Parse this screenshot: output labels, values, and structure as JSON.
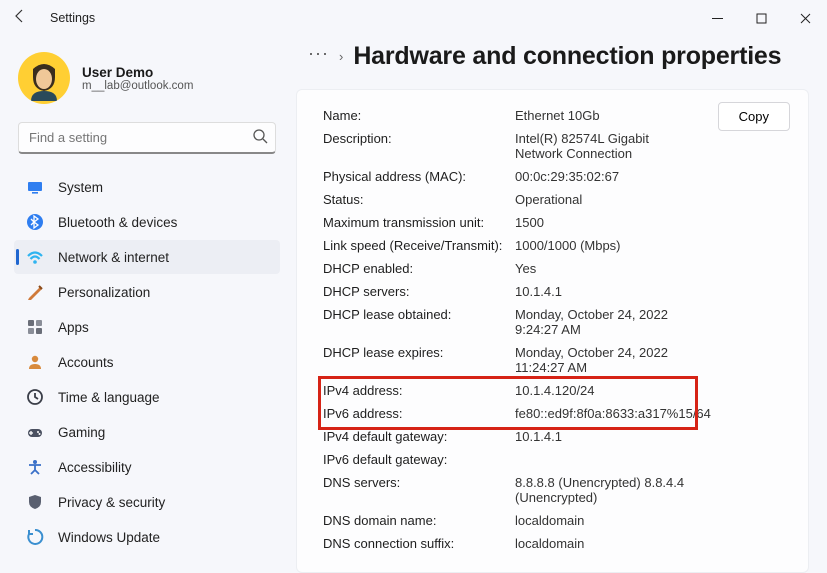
{
  "window": {
    "title": "Settings"
  },
  "user": {
    "name": "User Demo",
    "email": "m__lab@outlook.com"
  },
  "search": {
    "placeholder": "Find a setting"
  },
  "nav": [
    {
      "id": "system",
      "label": "System",
      "icon": "system",
      "color": "#2f7ef0"
    },
    {
      "id": "bluetooth",
      "label": "Bluetooth & devices",
      "icon": "bluetooth",
      "color": "#2f7ef0"
    },
    {
      "id": "network",
      "label": "Network & internet",
      "icon": "wifi",
      "color": "#2fb4f0",
      "selected": true
    },
    {
      "id": "personalization",
      "label": "Personalization",
      "icon": "personalization",
      "color": "#d07a3a"
    },
    {
      "id": "apps",
      "label": "Apps",
      "icon": "apps",
      "color": "#6a6e78"
    },
    {
      "id": "accounts",
      "label": "Accounts",
      "icon": "accounts",
      "color": "#d88a3c"
    },
    {
      "id": "time",
      "label": "Time & language",
      "icon": "time",
      "color": "#3a3e48"
    },
    {
      "id": "gaming",
      "label": "Gaming",
      "icon": "gaming",
      "color": "#4a5060"
    },
    {
      "id": "accessibility",
      "label": "Accessibility",
      "icon": "accessibility",
      "color": "#3a70c8"
    },
    {
      "id": "privacy",
      "label": "Privacy & security",
      "icon": "privacy",
      "color": "#5a6070"
    },
    {
      "id": "update",
      "label": "Windows Update",
      "icon": "update",
      "color": "#3a8fd0"
    }
  ],
  "page": {
    "title": "Hardware and connection properties",
    "copy_label": "Copy",
    "rows": [
      {
        "k": "Name:",
        "v": "Ethernet 10Gb"
      },
      {
        "k": "Description:",
        "v": "Intel(R) 82574L Gigabit Network Connection"
      },
      {
        "k": "Physical address (MAC):",
        "v": "00:0c:29:35:02:67"
      },
      {
        "k": "Status:",
        "v": "Operational"
      },
      {
        "k": "Maximum transmission unit:",
        "v": "1500"
      },
      {
        "k": "Link speed (Receive/Transmit):",
        "v": "1000/1000 (Mbps)"
      },
      {
        "k": "DHCP enabled:",
        "v": "Yes"
      },
      {
        "k": "DHCP servers:",
        "v": "10.1.4.1"
      },
      {
        "k": "DHCP lease obtained:",
        "v": "Monday, October 24, 2022 9:24:27 AM"
      },
      {
        "k": "DHCP lease expires:",
        "v": "Monday, October 24, 2022 11:24:27 AM"
      },
      {
        "k": "IPv4 address:",
        "v": "10.1.4.120/24",
        "hl": true
      },
      {
        "k": "IPv6 address:",
        "v": "fe80::ed9f:8f0a:8633:a317%15/64",
        "hl": true
      },
      {
        "k": "IPv4 default gateway:",
        "v": "10.1.4.1"
      },
      {
        "k": "IPv6 default gateway:",
        "v": ""
      },
      {
        "k": "DNS servers:",
        "v": "8.8.8.8 (Unencrypted) 8.8.4.4 (Unencrypted)"
      },
      {
        "k": "DNS domain name:",
        "v": "localdomain"
      },
      {
        "k": "DNS connection suffix:",
        "v": "localdomain"
      }
    ]
  },
  "icons": {
    "system": "<rect x='2' y='4' width='14' height='9' rx='1' fill='#2f7ef0'/><rect x='6' y='14' width='6' height='1.6' fill='#2f7ef0'/>",
    "bluetooth": "<circle cx='9' cy='9' r='8' fill='#2f7ef0'/><path d='M8 3 L12 6 L8 9 L12 12 L8 15 Z M8 9 L5 6 M8 9 L5 12' stroke='#fff' stroke-width='1.3' fill='none'/>",
    "wifi": "<path d='M2 8 Q9 1 16 8' stroke='#2fb4f0' stroke-width='2.2' fill='none'/><path d='M4.5 11 Q9 6 13.5 11' stroke='#2fb4f0' stroke-width='2.2' fill='none'/><circle cx='9' cy='14' r='1.8' fill='#2fb4f0'/>",
    "personalization": "<path d='M3 15 L14 4 L16 6 L5 17 L2 17 Z' fill='#d07a3a'/><path d='M13 3 L16 6' stroke='#8a4a1a' stroke-width='2'/>",
    "apps": "<rect x='2' y='2' width='6' height='6' rx='1' fill='#6a6e78'/><rect x='10' y='2' width='6' height='6' rx='1' fill='#8a8e98'/><rect x='2' y='10' width='6' height='6' rx='1' fill='#8a8e98'/><rect x='10' y='10' width='6' height='6' rx='1' fill='#6a6e78'/>",
    "accounts": "<circle cx='9' cy='6' r='3.2' fill='#d88a3c'/><path d='M3 16 Q3 11 9 11 Q15 11 15 16 Z' fill='#d88a3c'/>",
    "time": "<circle cx='9' cy='9' r='7' fill='none' stroke='#3a3e48' stroke-width='1.8'/><path d='M9 5 L9 9 L12 11' stroke='#3a3e48' stroke-width='1.8' fill='none'/>",
    "gaming": "<rect x='2' y='6' width='14' height='8' rx='4' fill='#4a5060'/><circle cx='12' cy='9' r='1' fill='#fff'/><circle cx='13.5' cy='11' r='1' fill='#fff'/><path d='M5 8 L5 12 M3 10 L7 10' stroke='#fff' stroke-width='1.3'/>",
    "accessibility": "<circle cx='9' cy='4' r='2' fill='#3a70c8'/><path d='M3 7 L15 7 M9 7 L9 12 M9 12 L5 16 M9 12 L13 16' stroke='#3a70c8' stroke-width='1.8' fill='none'/>",
    "privacy": "<path d='M9 2 L15 4 L15 9 Q15 14 9 16 Q3 14 3 9 L3 4 Z' fill='#5a6070'/>",
    "update": "<path d='M9 2 A7 7 0 1 1 3 6' stroke='#3a8fd0' stroke-width='2' fill='none'/><path d='M3 2 L3 6 L7 6' stroke='#3a8fd0' stroke-width='2' fill='none'/>"
  }
}
